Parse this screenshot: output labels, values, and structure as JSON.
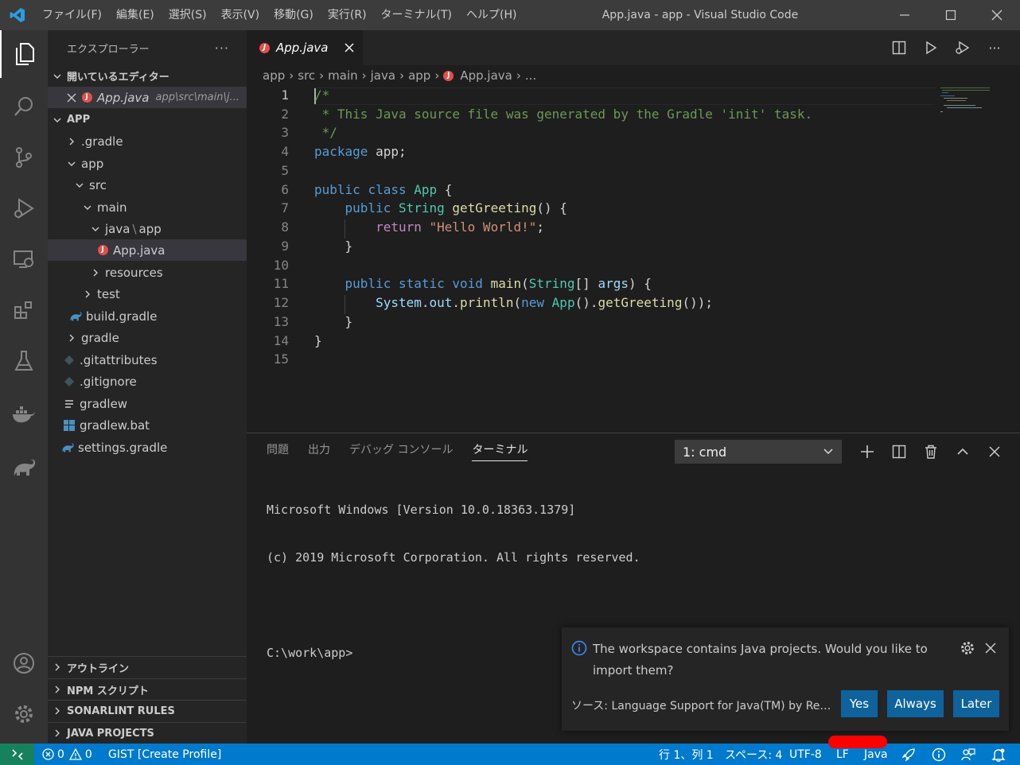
{
  "window": {
    "title": "App.java - app - Visual Studio Code",
    "menu": [
      "ファイル(F)",
      "編集(E)",
      "選択(S)",
      "表示(V)",
      "移動(G)",
      "実行(R)",
      "ターミナル(T)",
      "ヘルプ(H)"
    ]
  },
  "sidebar": {
    "title": "エクスプローラー",
    "open_editors": {
      "label": "開いているエディター",
      "items": [
        {
          "name": "App.java",
          "path": "app\\src\\main\\j..."
        }
      ]
    },
    "workspace_label": "APP",
    "tree": [
      {
        "name": ".gradle",
        "type": "folder",
        "expanded": false,
        "depth": 1
      },
      {
        "name": "app",
        "type": "folder",
        "expanded": true,
        "depth": 1
      },
      {
        "name": "src",
        "type": "folder",
        "expanded": true,
        "depth": 2
      },
      {
        "name": "main",
        "type": "folder",
        "expanded": true,
        "depth": 3
      },
      {
        "name": "java",
        "name2": "app",
        "type": "folder",
        "expanded": true,
        "depth": 4
      },
      {
        "name": "App.java",
        "type": "java",
        "depth": 5,
        "selected": true
      },
      {
        "name": "resources",
        "type": "folder",
        "expanded": false,
        "depth": 4
      },
      {
        "name": "test",
        "type": "folder",
        "expanded": false,
        "depth": 3
      },
      {
        "name": "build.gradle",
        "type": "gradle",
        "depth": 2
      },
      {
        "name": "gradle",
        "type": "folder",
        "expanded": false,
        "depth": 1
      },
      {
        "name": ".gitattributes",
        "type": "git",
        "depth": 1
      },
      {
        "name": ".gitignore",
        "type": "git",
        "depth": 1
      },
      {
        "name": "gradlew",
        "type": "text",
        "depth": 1
      },
      {
        "name": "gradlew.bat",
        "type": "windows",
        "depth": 1
      },
      {
        "name": "settings.gradle",
        "type": "gradle",
        "depth": 1
      }
    ],
    "sections": [
      "アウトライン",
      "NPM スクリプト",
      "SONARLINT RULES",
      "JAVA PROJECTS"
    ]
  },
  "editor": {
    "tab": "App.java",
    "breadcrumb": [
      "app",
      "src",
      "main",
      "java",
      "app",
      "App.java",
      "..."
    ],
    "lines": [
      "/*",
      " * This Java source file was generated by the Gradle 'init' task.",
      " */",
      "package app;",
      "",
      "public class App {",
      "    public String getGreeting() {",
      "        return \"Hello World!\";",
      "    }",
      "",
      "    public static void main(String[] args) {",
      "        System.out.println(new App().getGreeting());",
      "    }",
      "}",
      ""
    ],
    "tokens": {
      "l2": " * This Java source file was generated by the Gradle 'init' task.",
      "l3": " */",
      "kw_package": "package",
      "pkg_name": " app;",
      "kw_public": "public",
      "kw_class": "class",
      "cls_app": "App",
      "type_string": "String",
      "fn_getgreeting": "getGreeting",
      "parens_brace": "() {",
      "kw_return": "return",
      "str_hello": "\"Hello World!\"",
      "semi": ";",
      "brace_close": "}",
      "kw_static": "static",
      "kw_void": "void",
      "fn_main": "main",
      "open_paren": "(",
      "arr": "[] ",
      "var_args": "args",
      "close_brace_open": ") {",
      "cls_system": "System",
      "dot": ".",
      "var_out": "out",
      "fn_println": "println",
      "kw_new": "new",
      "paren_dot": "().",
      "paren_end": "());",
      "space": " ",
      "brace_open": " {"
    }
  },
  "panel": {
    "tabs": [
      "問題",
      "出力",
      "デバッグ コンソール",
      "ターミナル"
    ],
    "active_tab": "ターミナル",
    "terminal_select": "1: cmd",
    "terminal_lines": [
      "Microsoft Windows [Version 10.0.18363.1379]",
      "(c) 2019 Microsoft Corporation. All rights reserved.",
      "",
      "C:\\work\\app>"
    ]
  },
  "notification": {
    "message": "The workspace contains Java projects. Would you like to import them?",
    "source": "ソース: Language Support for Java(TM) by Red Ha...",
    "buttons": [
      "Yes",
      "Always",
      "Later"
    ]
  },
  "statusbar": {
    "errors": "0",
    "warnings": "0",
    "gist": "GIST [Create Profile]",
    "position": "行 1、列 1",
    "spaces": "スペース: 4",
    "encoding": "UTF-8",
    "eol": "LF",
    "language": "Java"
  },
  "colors": {
    "accent": "#007acc",
    "remote": "#16825d",
    "button": "#0e639c",
    "java_icon": "#e2504b"
  }
}
